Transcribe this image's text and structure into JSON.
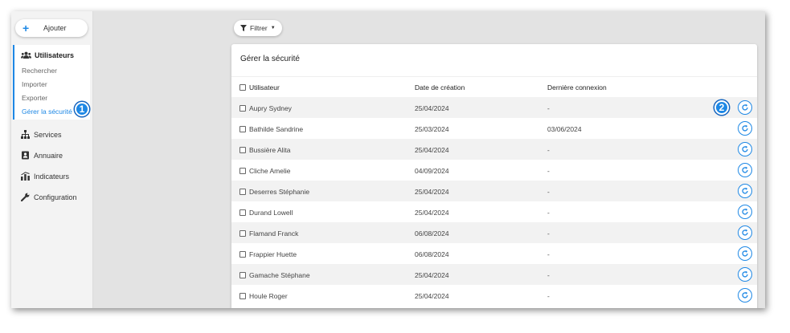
{
  "sidebar": {
    "add_label": "Ajouter",
    "section": {
      "title": "Utilisateurs",
      "items": [
        "Rechercher",
        "Importer",
        "Exporter",
        "Gérer la sécurité"
      ]
    },
    "callout_1": "1",
    "nav": [
      "Services",
      "Annuaire",
      "Indicateurs",
      "Configuration"
    ]
  },
  "filter": {
    "label": "Filtrer"
  },
  "panel": {
    "title": "Gérer la sécurité",
    "columns": [
      "Utilisateur",
      "Date de création",
      "Dernière connexion"
    ],
    "callout_2": "2",
    "rows": [
      {
        "user": "Aupry Sydney",
        "created": "25/04/2024",
        "last": "-"
      },
      {
        "user": "Bathilde Sandrine",
        "created": "25/03/2024",
        "last": "03/06/2024"
      },
      {
        "user": "Bussière Alita",
        "created": "25/04/2024",
        "last": "-"
      },
      {
        "user": "Cliche Amelie",
        "created": "04/09/2024",
        "last": "-"
      },
      {
        "user": "Deserres Stéphanie",
        "created": "25/04/2024",
        "last": "-"
      },
      {
        "user": "Durand Lowell",
        "created": "25/04/2024",
        "last": "-"
      },
      {
        "user": "Flamand Franck",
        "created": "06/08/2024",
        "last": "-"
      },
      {
        "user": "Frappier Huette",
        "created": "06/08/2024",
        "last": "-"
      },
      {
        "user": "Gamache Stéphane",
        "created": "25/04/2024",
        "last": "-"
      },
      {
        "user": "Houle Roger",
        "created": "25/04/2024",
        "last": "-"
      }
    ]
  },
  "colors": {
    "accent": "#1e88e5",
    "sidebar_bg": "#f3f3f3",
    "stripe": "#f2f2f2"
  },
  "icons": {
    "add": "plus-icon",
    "users": "users-icon",
    "services": "sitemap-icon",
    "annuaire": "contact-book-icon",
    "indicateurs": "chart-icon",
    "configuration": "wrench-icon",
    "filter": "funnel-icon",
    "reset": "reset-icon"
  }
}
